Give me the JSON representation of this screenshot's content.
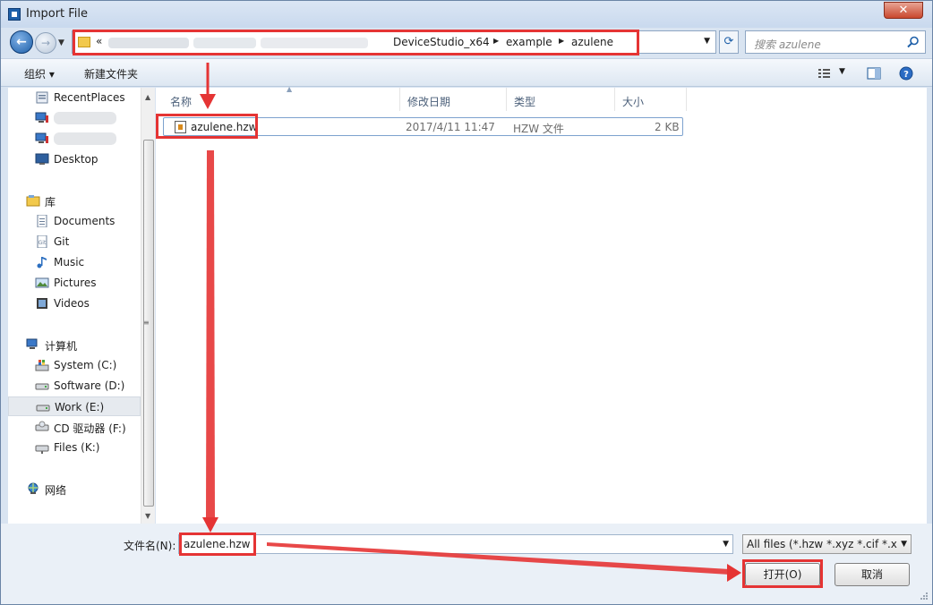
{
  "window": {
    "title": "Import File",
    "close_label": "✕"
  },
  "address": {
    "overflow_chevron": "«",
    "crumbs": [
      "DeviceStudio_x64",
      "example",
      "azulene"
    ]
  },
  "search": {
    "placeholder": "搜索 azulene"
  },
  "toolbar": {
    "organize": "组织 ▾",
    "new_folder": "新建文件夹"
  },
  "sidebar": {
    "items": [
      {
        "label": "RecentPlaces"
      },
      {
        "label": ""
      },
      {
        "label": ""
      },
      {
        "label": "Desktop"
      },
      {
        "label": "库"
      },
      {
        "label": "Documents"
      },
      {
        "label": "Git"
      },
      {
        "label": "Music"
      },
      {
        "label": "Pictures"
      },
      {
        "label": "Videos"
      },
      {
        "label": "计算机"
      },
      {
        "label": "System (C:)"
      },
      {
        "label": "Software (D:)"
      },
      {
        "label": "Work (E:)"
      },
      {
        "label": "CD 驱动器 (F:)"
      },
      {
        "label": "Files (K:)"
      },
      {
        "label": "网络"
      }
    ]
  },
  "columns": {
    "name": "名称",
    "date": "修改日期",
    "type": "类型",
    "size": "大小"
  },
  "files": [
    {
      "name": "azulene.hzw",
      "date": "2017/4/11 11:47",
      "type": "HZW 文件",
      "size": "2 KB"
    }
  ],
  "footer": {
    "filename_label": "文件名(N):",
    "filename_value": "azulene.hzw",
    "filetype_value": "All files (*.hzw *.xyz *.cif *.xsd",
    "open_button": "打开(O)",
    "cancel_button": "取消"
  },
  "colors": {
    "annotation": "#e53434",
    "window_frame": "#d9e4f1",
    "accent": "#1d5fa8"
  }
}
